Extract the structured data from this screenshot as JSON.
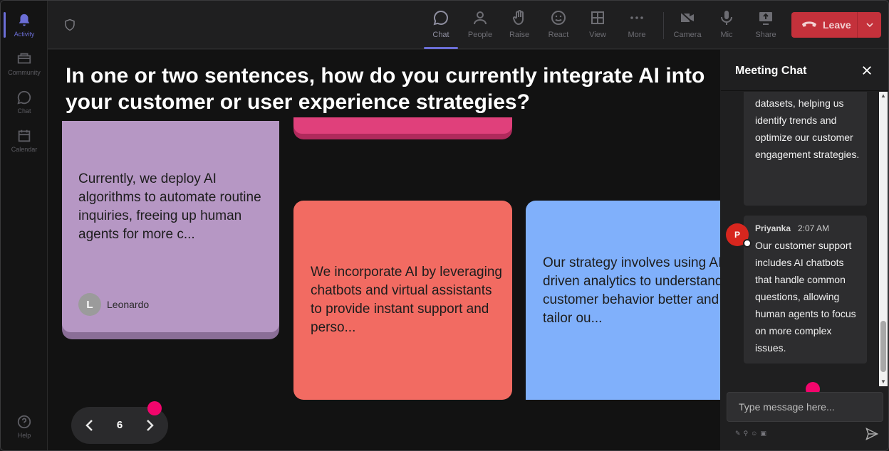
{
  "rail": {
    "items": [
      {
        "label": "Activity",
        "icon": "bell-icon"
      },
      {
        "label": "Community",
        "icon": "community-icon"
      },
      {
        "label": "Chat",
        "icon": "chat-icon"
      },
      {
        "label": "Calendar",
        "icon": "calendar-icon"
      }
    ],
    "help": {
      "label": "Help",
      "icon": "help-icon"
    }
  },
  "toolbar": {
    "chat": "Chat",
    "people": "People",
    "raise": "Raise",
    "react": "React",
    "view": "View",
    "more": "More",
    "camera": "Camera",
    "mic": "Mic",
    "share": "Share",
    "leave": "Leave"
  },
  "stage": {
    "question": "In one or two sentences, how do you currently integrate AI into your customer or user experience strategies?",
    "cards": [
      {
        "text": "Currently, we deploy AI algorithms to automate routine inquiries, freeing up human agents for more c...",
        "author": "Leonardo",
        "initial": "L",
        "color": "#b697c4"
      },
      {
        "text": "",
        "color": "#e0407b"
      },
      {
        "text": "We incorporate AI by leveraging chatbots and virtual assistants to provide instant support and perso...",
        "color": "#f26b62"
      },
      {
        "text": "Our strategy involves using AI-driven analytics to understand customer behavior better and tailor ou...",
        "color": "#80b0fb"
      }
    ],
    "pager": {
      "page": "6"
    }
  },
  "chat": {
    "title": "Meeting Chat",
    "messages": [
      {
        "text": "datasets, helping us identify trends and optimize our customer engagement strategies."
      },
      {
        "author": "Priyanka",
        "initial": "P",
        "time": "2:07 AM",
        "text": "Our customer support includes AI chatbots that handle common questions, allowing human agents to focus on more complex issues."
      }
    ],
    "input_placeholder": "Type message here..."
  },
  "colors": {
    "accent": "#6b6ed6",
    "leave": "#c4313b",
    "highlight_dot": "#f2056c"
  }
}
